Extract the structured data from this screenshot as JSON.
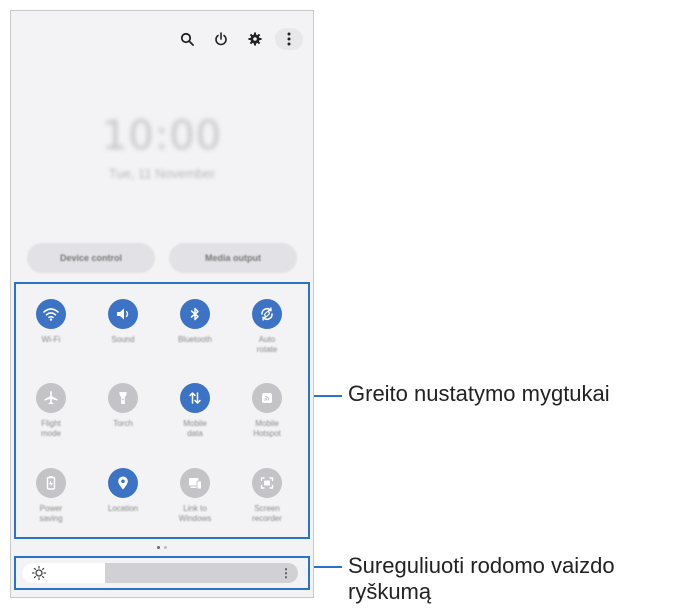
{
  "header": {
    "icons": [
      "search-icon",
      "power-icon",
      "gear-icon",
      "more-vertical-icon"
    ]
  },
  "clock": {
    "time": "10:00",
    "date": "Tue, 11 November"
  },
  "controls": {
    "device_control": "Device control",
    "media_output": "Media output"
  },
  "quick_settings": {
    "tiles": [
      {
        "label": "Wi-Fi",
        "icon": "wifi-icon",
        "on": true
      },
      {
        "label": "Sound",
        "icon": "sound-icon",
        "on": true
      },
      {
        "label": "Bluetooth",
        "icon": "bluetooth-icon",
        "on": true
      },
      {
        "label": "Auto\nrotate",
        "icon": "rotate-icon",
        "on": true
      },
      {
        "label": "Flight\nmode",
        "icon": "airplane-icon",
        "on": false
      },
      {
        "label": "Torch",
        "icon": "flashlight-icon",
        "on": false
      },
      {
        "label": "Mobile\ndata",
        "icon": "mobile-data-icon",
        "on": true
      },
      {
        "label": "Mobile\nHotspot",
        "icon": "hotspot-icon",
        "on": false
      },
      {
        "label": "Power\nsaving",
        "icon": "battery-icon",
        "on": false
      },
      {
        "label": "Location",
        "icon": "location-icon",
        "on": true
      },
      {
        "label": "Link to Windows",
        "icon": "link-windows-icon",
        "on": false
      },
      {
        "label": "Screen recorder",
        "icon": "screen-recorder-icon",
        "on": false
      }
    ]
  },
  "page_indicator": {
    "current": 1,
    "total": 2
  },
  "brightness": {
    "level": 0.3,
    "icon": "sun-icon"
  },
  "callouts": {
    "quick_buttons": "Greito nustatymo mygtukai",
    "brightness": "Sureguliuoti rodomo vaizdo\nryškumą"
  },
  "colors": {
    "accent": "#3d73c4",
    "frame": "#2b73c8",
    "off": "#c4c4c8"
  }
}
